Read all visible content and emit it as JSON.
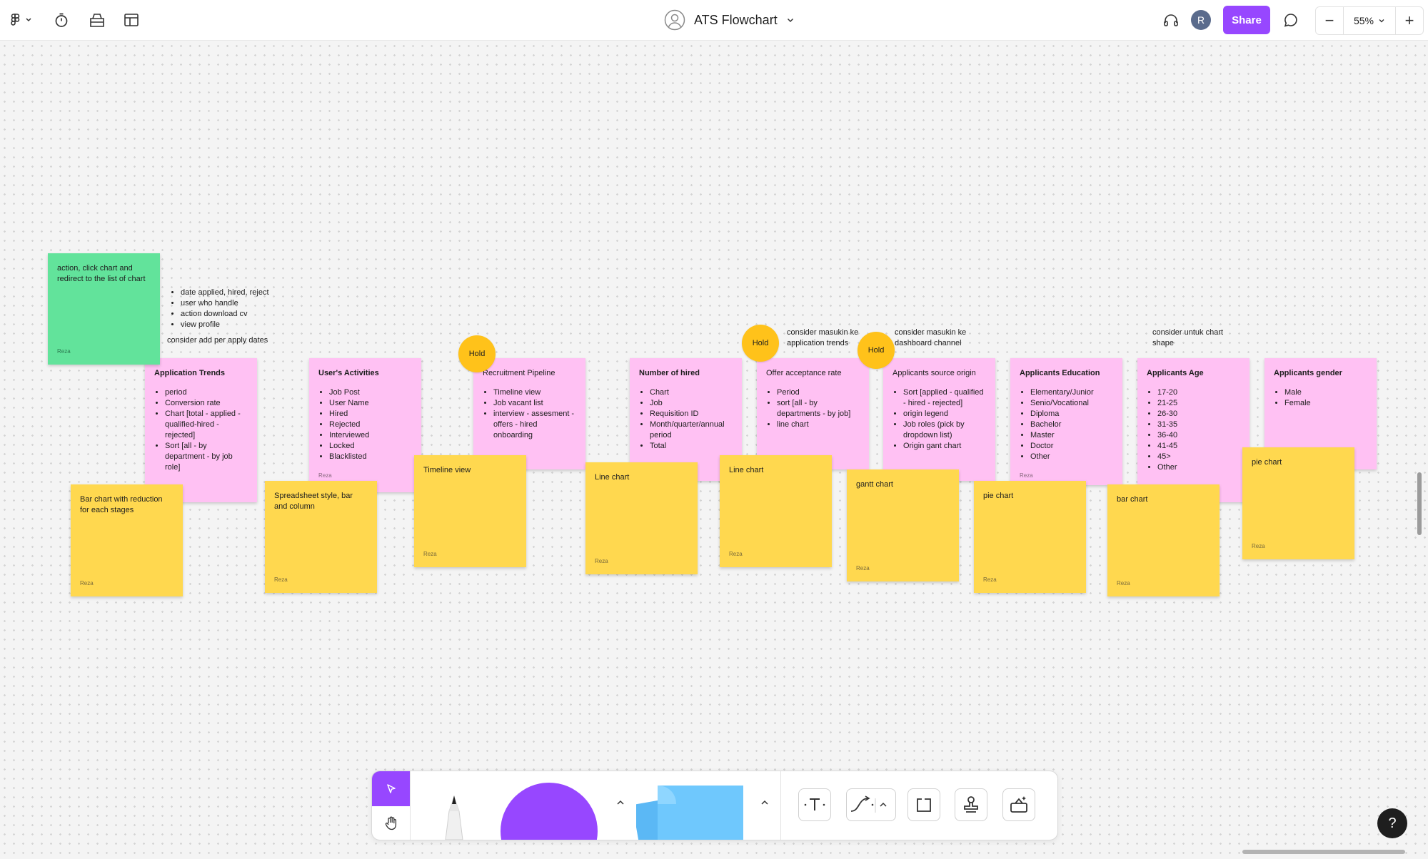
{
  "header": {
    "title": "ATS Flowchart",
    "share_label": "Share",
    "avatar_initial": "R",
    "zoom": "55%",
    "zoom_out": "−",
    "zoom_in": "+"
  },
  "stickies": {
    "green": {
      "text": "action, click chart and redirect to the list of chart",
      "author": "Reza"
    },
    "application_trends": {
      "title": "Application Trends",
      "items": [
        "period",
        "Conversion rate",
        "Chart [total - applied - qualified-hired - rejected]",
        "Sort [all - by department - by job role]"
      ]
    },
    "users_activities": {
      "title": "User's Activities",
      "items": [
        "Job Post",
        "User Name",
        "Hired",
        "Rejected",
        "Interviewed",
        "Locked",
        "Blacklisted"
      ],
      "author": "Reza"
    },
    "recruitment_pipeline": {
      "title": "Recruitment Pipeline",
      "items": [
        "Timeline view",
        "Job vacant list",
        "interview - assesment - offers - hired onboarding"
      ]
    },
    "number_of_hired": {
      "title": "Number of hired",
      "items": [
        "Chart",
        "Job",
        "Requisition ID",
        "Month/quarter/annual period",
        "Total"
      ]
    },
    "offer_acceptance": {
      "title": "Offer acceptance rate",
      "items": [
        "Period",
        "sort [all - by departments - by job]",
        "line chart"
      ]
    },
    "applicants_source": {
      "title": "Applicants source origin",
      "items": [
        "Sort [applied - qualified - hired - rejected]",
        "origin legend",
        "Job roles (pick by dropdown list)",
        "Origin gant chart"
      ]
    },
    "applicants_education": {
      "title": "Applicants Education",
      "items": [
        "Elementary/Junior",
        "Senio/Vocational",
        "Diploma",
        "Bachelor",
        "Master",
        "Doctor",
        "Other"
      ],
      "author": "Reza"
    },
    "applicants_age": {
      "title": "Applicants Age",
      "items": [
        "17-20",
        "21-25",
        "26-30",
        "31-35",
        "36-40",
        "41-45",
        "45>",
        "Other"
      ]
    },
    "applicants_gender": {
      "title": "Applicants gender",
      "items": [
        "Male",
        "Female"
      ]
    },
    "y1": {
      "text": "Bar chart with reduction for each stages",
      "author": "Reza"
    },
    "y2": {
      "text": "Spreadsheet style, bar and column",
      "author": "Reza"
    },
    "y3": {
      "text": "Timeline view",
      "author": "Reza"
    },
    "y4": {
      "text": "Line chart",
      "author": "Reza"
    },
    "y5": {
      "text": "Line chart",
      "author": "Reza"
    },
    "y6": {
      "text": "gantt chart",
      "author": "Reza"
    },
    "y7": {
      "text": "pie chart",
      "author": "Reza"
    },
    "y8": {
      "text": "bar chart",
      "author": "Reza"
    },
    "y9": {
      "text": "pie chart",
      "author": "Reza"
    }
  },
  "holds": [
    "Hold",
    "Hold",
    "Hold"
  ],
  "notes": {
    "list": [
      "date applied, hired, reject",
      "user who handle",
      "action download cv",
      "view profile"
    ],
    "apply_dates": "consider add per apply dates",
    "n1": "consider masukin ke application trends",
    "n2": "consider masukin ke dashboard channel",
    "n3": "consider untuk chart shape"
  },
  "toolbar": {
    "icons": [
      "move-icon",
      "hand-icon",
      "pen-icon",
      "shape-icon",
      "sticky-icon",
      "text-icon",
      "connector-icon",
      "section-icon",
      "stamp-icon",
      "more-tools-icon"
    ],
    "colors": {
      "accent": "#9747ff",
      "shape": "#9747ff",
      "sticky": "#6fc8fd"
    }
  },
  "help_label": "?"
}
